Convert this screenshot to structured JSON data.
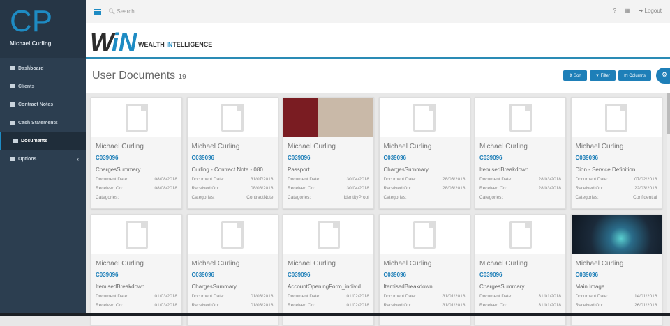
{
  "sidebar": {
    "logo": "CP",
    "user": "Michael Curling",
    "items": [
      {
        "label": "Dashboard",
        "icon": "dashboard-icon"
      },
      {
        "label": "Clients",
        "icon": "id-card-icon"
      },
      {
        "label": "Contract Notes",
        "icon": "file-icon"
      },
      {
        "label": "Cash Statements",
        "icon": "money-icon"
      },
      {
        "label": "Documents",
        "icon": "document-icon",
        "active": true
      },
      {
        "label": "Options",
        "icon": "list-icon"
      }
    ]
  },
  "topbar": {
    "search_placeholder": "Search...",
    "help": "?",
    "logout": "Logout"
  },
  "logo": {
    "mark_w": "W",
    "mark_n": "iN",
    "text_a": "WEALTH ",
    "text_b": "IN",
    "text_c": "TELLIGENCE"
  },
  "page": {
    "title": "User Documents",
    "count": "19",
    "sort": "Sort",
    "filter": "Filter",
    "columns": "Columns"
  },
  "labels": {
    "doc_date": "Document Date:",
    "received": "Received On:",
    "categories": "Categories:"
  },
  "cards": [
    {
      "name": "Michael Curling",
      "code": "C039096",
      "type": "ChargesSummary",
      "doc_date": "08/08/2018",
      "received": "08/08/2018",
      "category": "",
      "thumb": "pdf"
    },
    {
      "name": "Michael Curling",
      "code": "C039096",
      "type": "Curling - Contract Note - 080...",
      "doc_date": "31/07/2018",
      "received": "08/08/2018",
      "category": "ContractNote",
      "thumb": "pdf"
    },
    {
      "name": "Michael Curling",
      "code": "C039096",
      "type": "Passport",
      "doc_date": "30/04/2018",
      "received": "30/04/2018",
      "category": "IdentityProof",
      "thumb": "passport"
    },
    {
      "name": "Michael Curling",
      "code": "C039096",
      "type": "ChargesSummary",
      "doc_date": "28/03/2018",
      "received": "28/03/2018",
      "category": "",
      "thumb": "pdf"
    },
    {
      "name": "Michael Curling",
      "code": "C039096",
      "type": "ItemisedBreakdown",
      "doc_date": "28/03/2018",
      "received": "28/03/2018",
      "category": "",
      "thumb": "pdf"
    },
    {
      "name": "Michael Curling",
      "code": "C039096",
      "type": "Dion - Service Definition",
      "doc_date": "07/02/2018",
      "received": "22/03/2018",
      "category": "Confidential",
      "thumb": "pdf"
    },
    {
      "name": "Michael Curling",
      "code": "C039096",
      "type": "ItemisedBreakdown",
      "doc_date": "01/03/2018",
      "received": "01/03/2018",
      "thumb": "pdf"
    },
    {
      "name": "Michael Curling",
      "code": "C039096",
      "type": "ChargesSummary",
      "doc_date": "01/03/2018",
      "received": "01/03/2018",
      "thumb": "pdf"
    },
    {
      "name": "Michael Curling",
      "code": "C039096",
      "type": "AccountOpeningForm_individ...",
      "doc_date": "01/02/2018",
      "received": "01/02/2018",
      "thumb": "pdf"
    },
    {
      "name": "Michael Curling",
      "code": "C039096",
      "type": "ItemisedBreakdown",
      "doc_date": "31/01/2018",
      "received": "31/01/2018",
      "thumb": "pdf"
    },
    {
      "name": "Michael Curling",
      "code": "C039096",
      "type": "ChargesSummary",
      "doc_date": "31/01/2018",
      "received": "31/01/2018",
      "thumb": "pdf"
    },
    {
      "name": "Michael Curling",
      "code": "C039096",
      "type": "Main Image",
      "doc_date": "14/01/2016",
      "received": "26/01/2018",
      "thumb": "image"
    }
  ],
  "colors": {
    "accent": "#1e7fb8",
    "sidebar": "#2c3e50"
  }
}
